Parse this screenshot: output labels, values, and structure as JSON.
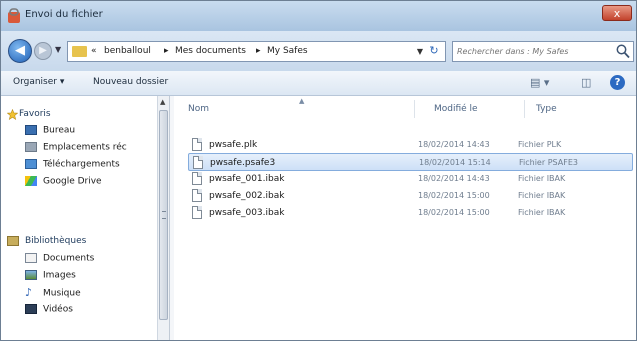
{
  "window": {
    "title": "Envoi du fichier",
    "close_label": "x"
  },
  "address": {
    "breadcrumb": [
      "benballoul",
      "Mes documents",
      "My Safes"
    ],
    "separator": "▸",
    "root_arrows": "«"
  },
  "search": {
    "placeholder": "Rechercher dans : My Safes"
  },
  "toolbar": {
    "organize_label": "Organiser ▾",
    "new_folder_label": "Nouveau dossier"
  },
  "sidebar": {
    "favorites": {
      "label": "Favoris",
      "items": [
        {
          "label": "Bureau",
          "icon": "desktop-icon"
        },
        {
          "label": "Emplacements réc",
          "icon": "recent-places-icon"
        },
        {
          "label": "Téléchargements",
          "icon": "downloads-icon"
        },
        {
          "label": "Google Drive",
          "icon": "google-drive-icon"
        }
      ]
    },
    "libraries": {
      "label": "Bibliothèques",
      "items": [
        {
          "label": "Documents",
          "icon": "documents-icon"
        },
        {
          "label": "Images",
          "icon": "images-icon"
        },
        {
          "label": "Musique",
          "icon": "music-icon"
        },
        {
          "label": "Vidéos",
          "icon": "videos-icon"
        }
      ]
    }
  },
  "columns": {
    "name": "Nom",
    "modified": "Modifié le",
    "type": "Type"
  },
  "files": [
    {
      "name": "pwsafe.plk",
      "modified": "18/02/2014 14:43",
      "type": "Fichier PLK",
      "selected": false
    },
    {
      "name": "pwsafe.psafe3",
      "modified": "18/02/2014 15:14",
      "type": "Fichier PSAFE3",
      "selected": true
    },
    {
      "name": "pwsafe_001.ibak",
      "modified": "18/02/2014 14:43",
      "type": "Fichier IBAK",
      "selected": false
    },
    {
      "name": "pwsafe_002.ibak",
      "modified": "18/02/2014 15:00",
      "type": "Fichier IBAK",
      "selected": false
    },
    {
      "name": "pwsafe_003.ibak",
      "modified": "18/02/2014 15:00",
      "type": "Fichier IBAK",
      "selected": false
    }
  ],
  "colors": {
    "accent": "#2c6ac2",
    "selection": "#cde0f7",
    "close": "#c2422c"
  }
}
